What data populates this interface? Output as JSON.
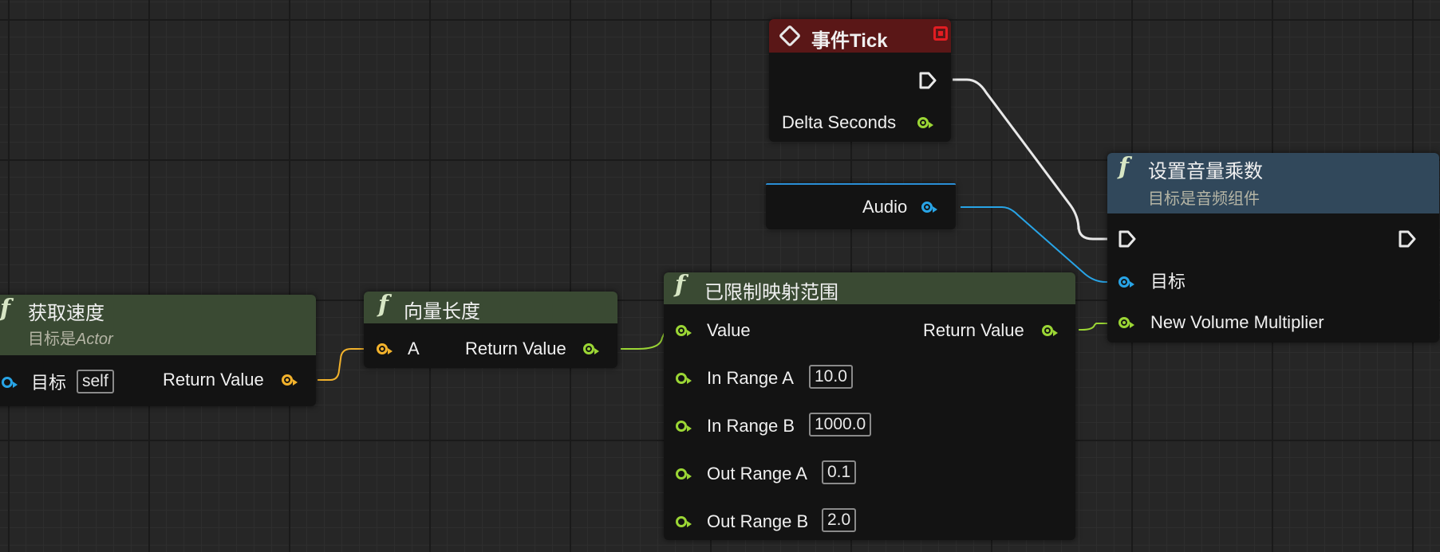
{
  "nodes": {
    "get_velocity": {
      "title": "获取速度",
      "subtitle_prefix": "目标是",
      "subtitle_target": "Actor",
      "pin_target_label": "目标",
      "pin_target_value": "self",
      "pin_return_label": "Return Value"
    },
    "vector_length": {
      "title": "向量长度",
      "pin_a_label": "A",
      "pin_return_label": "Return Value"
    },
    "event_tick": {
      "title": "事件Tick",
      "pin_delta_label": "Delta Seconds"
    },
    "audio_var": {
      "label": "Audio"
    },
    "map_range_clamped": {
      "title": "已限制映射范围",
      "pin_value_label": "Value",
      "pin_return_label": "Return Value",
      "inputs": [
        {
          "label": "In Range A",
          "value": "10.0"
        },
        {
          "label": "In Range B",
          "value": "1000.0"
        },
        {
          "label": "Out Range A",
          "value": "0.1"
        },
        {
          "label": "Out Range B",
          "value": "2.0"
        }
      ]
    },
    "set_volume_multiplier": {
      "title": "设置音量乘数",
      "subtitle": "目标是音频组件",
      "pin_target_label": "目标",
      "pin_multiplier_label": "New Volume Multiplier"
    }
  },
  "colors": {
    "exec_wire": "#e8e8e8",
    "float_wire": "#9bd635",
    "vector_wire": "#f2b22c",
    "object_wire": "#28a4e6",
    "grid_bg": "#262626"
  },
  "icons": {
    "function": "function-f-icon",
    "event": "event-diamond-icon",
    "stop": "stop-square-icon",
    "exec": "exec-arrow-icon"
  }
}
